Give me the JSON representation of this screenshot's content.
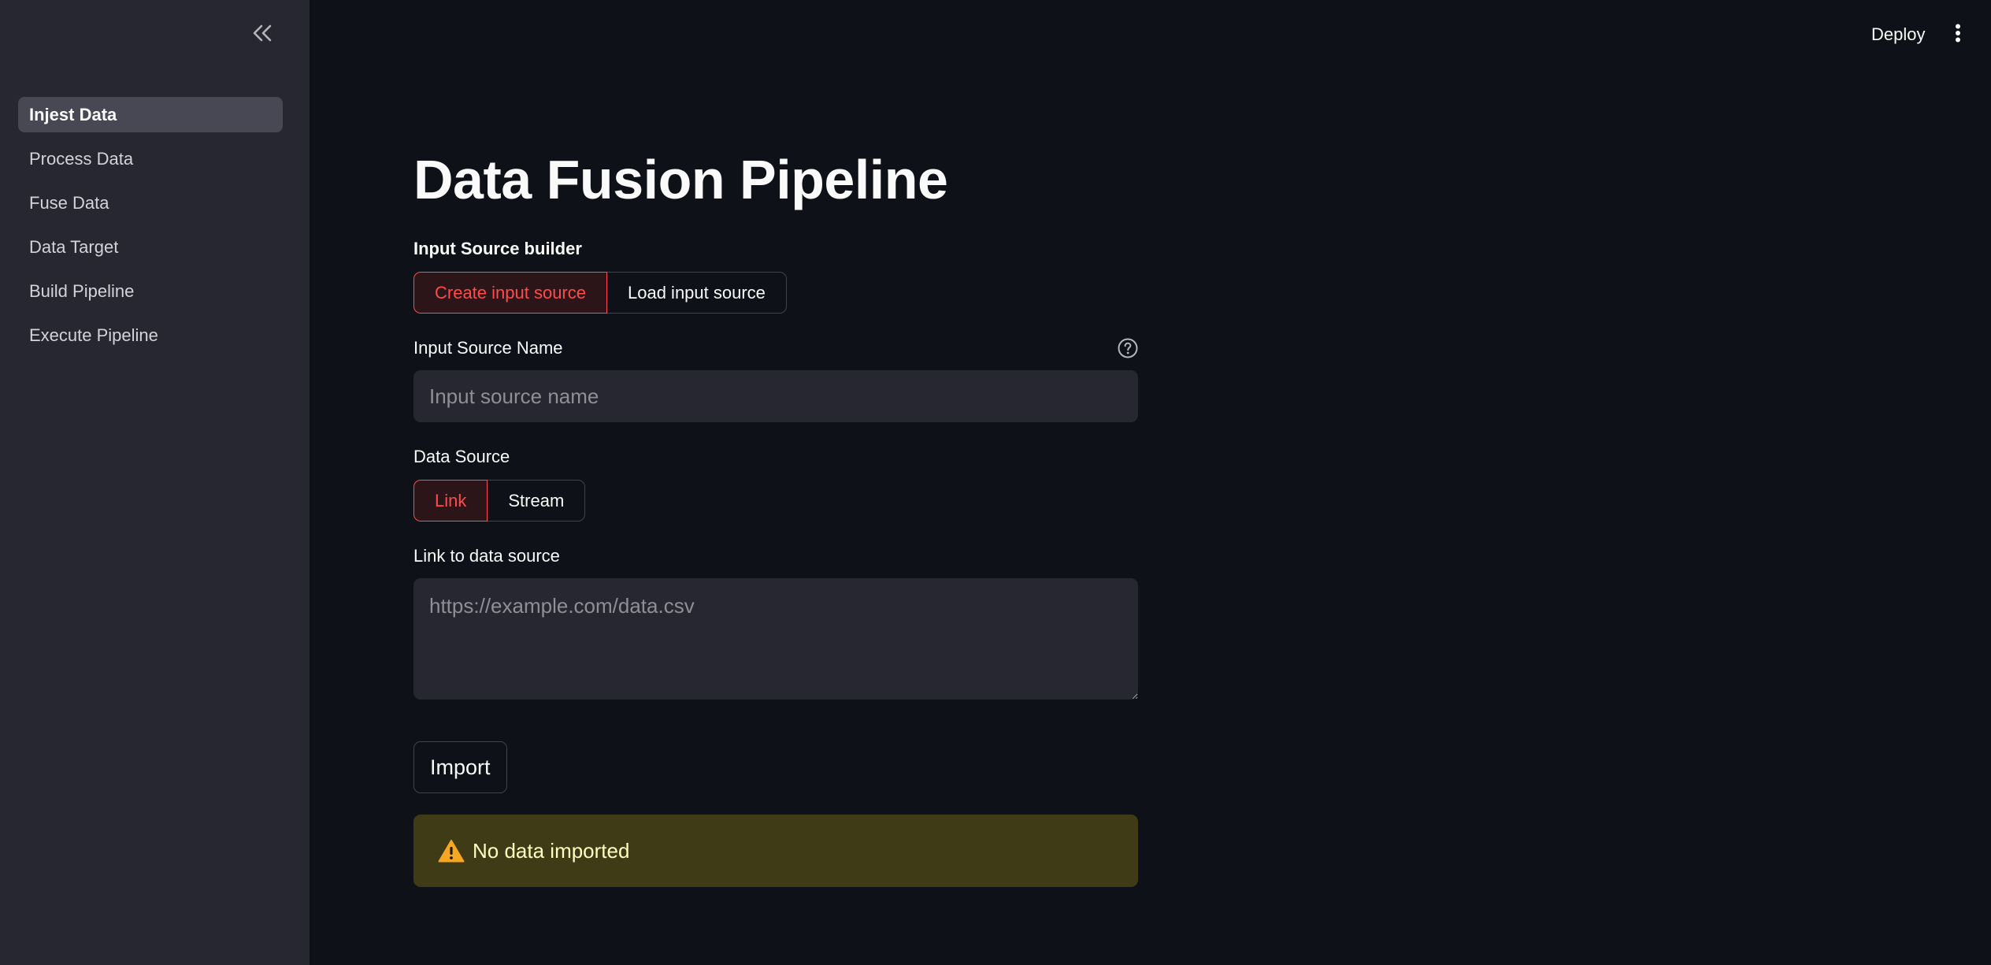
{
  "sidebar": {
    "collapse_icon": "double-chevron-left-icon",
    "items": [
      {
        "label": "Injest Data",
        "active": true
      },
      {
        "label": "Process Data",
        "active": false
      },
      {
        "label": "Fuse Data",
        "active": false
      },
      {
        "label": "Data Target",
        "active": false
      },
      {
        "label": "Build Pipeline",
        "active": false
      },
      {
        "label": "Execute Pipeline",
        "active": false
      }
    ]
  },
  "header": {
    "deploy_label": "Deploy",
    "menu_icon": "vertical-ellipsis-icon"
  },
  "main": {
    "title": "Data Fusion Pipeline",
    "builder": {
      "label": "Input Source builder",
      "options": [
        "Create input source",
        "Load input source"
      ],
      "selected": "Create input source"
    },
    "source_name": {
      "label": "Input Source Name",
      "placeholder": "Input source name",
      "value": "",
      "help_icon": "question-circle-icon"
    },
    "data_source": {
      "label": "Data Source",
      "options": [
        "Link",
        "Stream"
      ],
      "selected": "Link"
    },
    "link": {
      "label": "Link to data source",
      "placeholder": "https://example.com/data.csv",
      "value": ""
    },
    "import_label": "Import",
    "warning": {
      "icon": "warning-triangle-icon",
      "text": "No data imported"
    }
  },
  "colors": {
    "background": "#0e1117",
    "sidebar": "#262730",
    "accent": "#ff4b4b",
    "warning_bg": "#3e3b16",
    "warning_text": "#ffffc2"
  }
}
